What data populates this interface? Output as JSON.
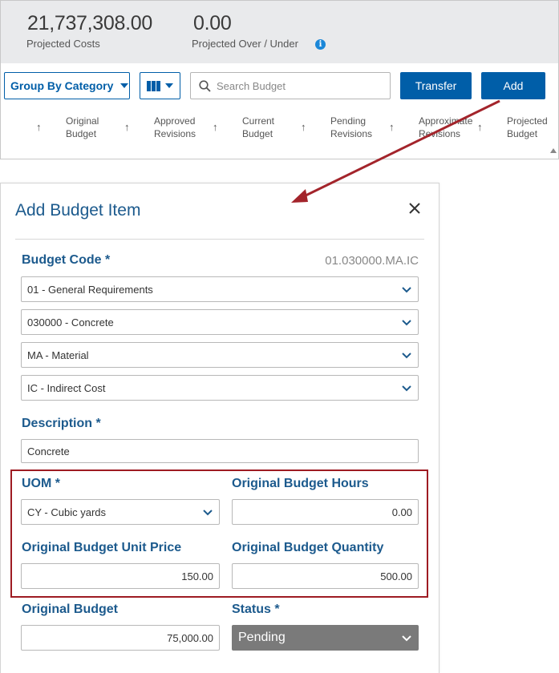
{
  "summary": {
    "projected_costs_value": "21,737,308.00",
    "projected_costs_label": "Projected Costs",
    "over_under_value": "0.00",
    "over_under_label": "Projected Over / Under",
    "info_glyph": "i"
  },
  "toolbar": {
    "group_by_label": "Group By Category",
    "search_placeholder": "Search Budget",
    "transfer_label": "Transfer",
    "add_label": "Add"
  },
  "columns": [
    {
      "line1": "Original",
      "line2": "Budget"
    },
    {
      "line1": "Approved",
      "line2": "Revisions"
    },
    {
      "line1": "Current",
      "line2": "Budget"
    },
    {
      "line1": "Pending",
      "line2": "Revisions"
    },
    {
      "line1": "Approximate",
      "line2": "Revisions"
    },
    {
      "line1": "Projected",
      "line2": "Budget"
    }
  ],
  "modal": {
    "title": "Add Budget Item",
    "budget_code_label": "Budget Code *",
    "budget_code_value": "01.030000.MA.IC",
    "code_selects": [
      "01 - General Requirements",
      "030000 - Concrete",
      "MA - Material",
      "IC - Indirect Cost"
    ],
    "description_label": "Description *",
    "description_value": "Concrete",
    "uom_label": "UOM *",
    "uom_value": "CY - Cubic yards",
    "hours_label": "Original Budget Hours",
    "hours_value": "0.00",
    "unit_price_label": "Original Budget Unit Price",
    "unit_price_value": "150.00",
    "quantity_label": "Original Budget Quantity",
    "quantity_value": "500.00",
    "original_budget_label": "Original Budget",
    "original_budget_value": "75,000.00",
    "status_label": "Status *",
    "status_value": "Pending"
  },
  "colors": {
    "primary": "#005ea8",
    "label_blue": "#1c5a8d",
    "annotation_red": "#9e1b22",
    "status_grey": "#7a7a7a"
  }
}
